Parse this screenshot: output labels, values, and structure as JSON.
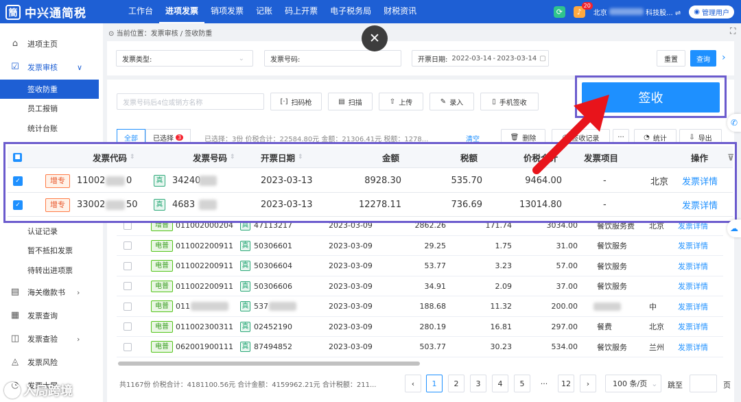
{
  "app": {
    "logo_glyph": "簡",
    "name": "中兴通简税"
  },
  "nav": [
    "工作台",
    "进项发票",
    "销项发票",
    "记账",
    "码上开票",
    "电子税务局",
    "财税资讯"
  ],
  "topbar": {
    "notification_count": "20",
    "company": "北京",
    "company_suffix": "科技股... ⇌",
    "user": "管理用户"
  },
  "sidebar": [
    {
      "icon": "home-icon",
      "glyph": "⌂",
      "label": "进项主页",
      "type": "main"
    },
    {
      "icon": "invoice-review-icon",
      "glyph": "☑",
      "label": "发票审核",
      "type": "main-open",
      "arrow": "∨"
    },
    {
      "label": "签收防重",
      "type": "sub-active"
    },
    {
      "label": "员工报销",
      "type": "sub"
    },
    {
      "label": "统计台账",
      "type": "sub"
    },
    {
      "label": "认证记录",
      "type": "sub"
    },
    {
      "label": "暂不抵扣发票",
      "type": "sub"
    },
    {
      "label": "待转出进项票",
      "type": "sub"
    },
    {
      "icon": "customs-icon",
      "glyph": "▤",
      "label": "海关缴款书",
      "type": "main",
      "arrow": "›"
    },
    {
      "icon": "query-icon",
      "glyph": "▦",
      "label": "发票查询",
      "type": "main"
    },
    {
      "icon": "check-icon",
      "glyph": "◫",
      "label": "发票查验",
      "type": "main",
      "arrow": "›"
    },
    {
      "icon": "risk-icon",
      "glyph": "◬",
      "label": "发票风险",
      "type": "main"
    },
    {
      "icon": "dashboard-icon",
      "glyph": "◔",
      "label": "发票大屏",
      "type": "main"
    }
  ],
  "breadcrumb": {
    "prefix": "当前位置：",
    "path": "发票审核 / 签收防重"
  },
  "filters": {
    "invoice_type_label": "发票类型:",
    "invoice_no_label": "发票号码:",
    "date_label": "开票日期:",
    "date_start": "2022-03-14",
    "date_sep": "-",
    "date_end": "2023-03-14",
    "reset": "重置",
    "query": "查询"
  },
  "toolbar": {
    "search_placeholder": "发票号码后4位或销方名称",
    "scan_gun": "扫码枪",
    "scan": "扫描",
    "upload": "上传",
    "entry": "录入",
    "mobile_sign": "手机签收",
    "sign": "签收"
  },
  "tabs": {
    "all": "全部",
    "selected": "已选择",
    "selected_count": "3"
  },
  "selection_info": "已选择：3份 价税合计：22584.80元 金额：21306.41元 税额：1278...",
  "actions": {
    "clear": "清空",
    "delete": "删除",
    "sign_record": "签收记录",
    "more": "···",
    "stats": "统计",
    "export": "导出"
  },
  "columns": [
    "发票代码",
    "发票号码",
    "开票日期",
    "金额",
    "税额",
    "价税合计",
    "发票项目",
    "操作"
  ],
  "highlight_rows": [
    {
      "type": "增专",
      "code": "11002",
      "code_end": "0",
      "zhen": "真",
      "number": "34240",
      "date": "2023-03-13",
      "amount": "8928.30",
      "tax": "535.70",
      "total": "9464.00",
      "item": "-",
      "seller": "北京",
      "op": "发票详情"
    },
    {
      "type": "增专",
      "code": "33002",
      "code_end": "50",
      "zhen": "真",
      "number": "4683",
      "date": "2023-03-13",
      "amount": "12278.11",
      "tax": "736.69",
      "total": "13014.80",
      "item": "-",
      "seller": "",
      "op": "发票详情"
    }
  ],
  "rows": [
    {
      "type": "增普",
      "code": "011002000204",
      "number": "47113217",
      "date": "2023-03-09",
      "amount": "2862.26",
      "tax": "171.74",
      "total": "3034.00",
      "item": "餐饮服务费",
      "seller": "北京",
      "op": "发票详情"
    },
    {
      "type": "电普",
      "code": "011002200911",
      "number": "50306601",
      "date": "2023-03-09",
      "amount": "29.25",
      "tax": "1.75",
      "total": "31.00",
      "item": "餐饮服务",
      "seller": "",
      "op": "发票详情"
    },
    {
      "type": "电普",
      "code": "011002200911",
      "number": "50306604",
      "date": "2023-03-09",
      "amount": "53.77",
      "tax": "3.23",
      "total": "57.00",
      "item": "餐饮服务",
      "seller": "",
      "op": "发票详情"
    },
    {
      "type": "电普",
      "code": "011002200911",
      "number": "50306606",
      "date": "2023-03-09",
      "amount": "34.91",
      "tax": "2.09",
      "total": "37.00",
      "item": "餐饮服务",
      "seller": "",
      "op": "发票详情"
    },
    {
      "type": "电普",
      "code": "011",
      "number": "537",
      "date": "2023-03-09",
      "amount": "188.68",
      "tax": "11.32",
      "total": "200.00",
      "item": "",
      "seller": "中",
      "op": "发票详情"
    },
    {
      "type": "电普",
      "code": "011002300311",
      "number": "02452190",
      "date": "2023-03-09",
      "amount": "280.19",
      "tax": "16.81",
      "total": "297.00",
      "item": "餐费",
      "seller": "北京",
      "op": "发票详情"
    },
    {
      "type": "电普",
      "code": "062001900111",
      "number": "87494852",
      "date": "2023-03-09",
      "amount": "503.77",
      "tax": "30.23",
      "total": "534.00",
      "item": "餐饮服务",
      "seller": "兰州",
      "op": "发票详情"
    }
  ],
  "footer": {
    "summary": "共1167份 价税合计：4181100.56元 合计金额：4159962.21元 合计税额：211...",
    "pages": [
      "1",
      "2",
      "3",
      "4",
      "5",
      "···",
      "12"
    ],
    "prev": "‹",
    "next": "›",
    "page_size": "100 条/页",
    "jump_label": "跳至",
    "page_suffix": "页"
  },
  "watermark": "入局跨境",
  "colors": {
    "primary": "#1e90ff",
    "topbar": "#1e5fd4",
    "highlight": "#6a5acd",
    "arrow": "#e8141b"
  }
}
